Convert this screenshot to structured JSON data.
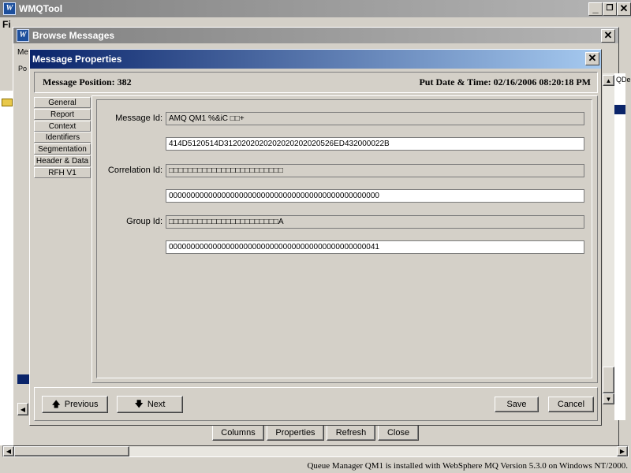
{
  "main_window": {
    "title": "WMQTool",
    "menu": {
      "file_partial": "Fi"
    }
  },
  "browse_window": {
    "title": "Browse Messages",
    "tab_partial": "Me",
    "col_left_partial": "Po",
    "col_right_partial": "QDe",
    "buttons": {
      "columns": "Columns",
      "properties": "Properties",
      "refresh": "Refresh",
      "close": "Close"
    }
  },
  "dialog": {
    "title": "Message Properties",
    "message_position_label": "Message Position: 382",
    "put_datetime_label": "Put Date & Time: 02/16/2006 08:20:18 PM",
    "tabs": [
      "General",
      "Report",
      "Context",
      "Identifiers",
      "Segmentation",
      "Header & Data",
      "RFH V1"
    ],
    "selected_tab": "Identifiers",
    "fields": {
      "message_id": {
        "label": "Message Id:",
        "text": "AMQ QM1         %&iC □□+",
        "hex": "414D5120514D3120202020202020202020526ED432000022B"
      },
      "correlation_id": {
        "label": "Correlation Id:",
        "text": "□□□□□□□□□□□□□□□□□□□□□□□□",
        "hex": "000000000000000000000000000000000000000000000000"
      },
      "group_id": {
        "label": "Group Id:",
        "text": "□□□□□□□□□□□□□□□□□□□□□□□A",
        "hex": "000000000000000000000000000000000000000000000041"
      }
    },
    "buttons": {
      "previous": "Previous",
      "next": "Next",
      "save": "Save",
      "cancel": "Cancel"
    }
  },
  "status_bar": {
    "text": "Queue Manager QM1  is installed with WebSphere MQ Version 5.3.0 on Windows NT/2000."
  }
}
